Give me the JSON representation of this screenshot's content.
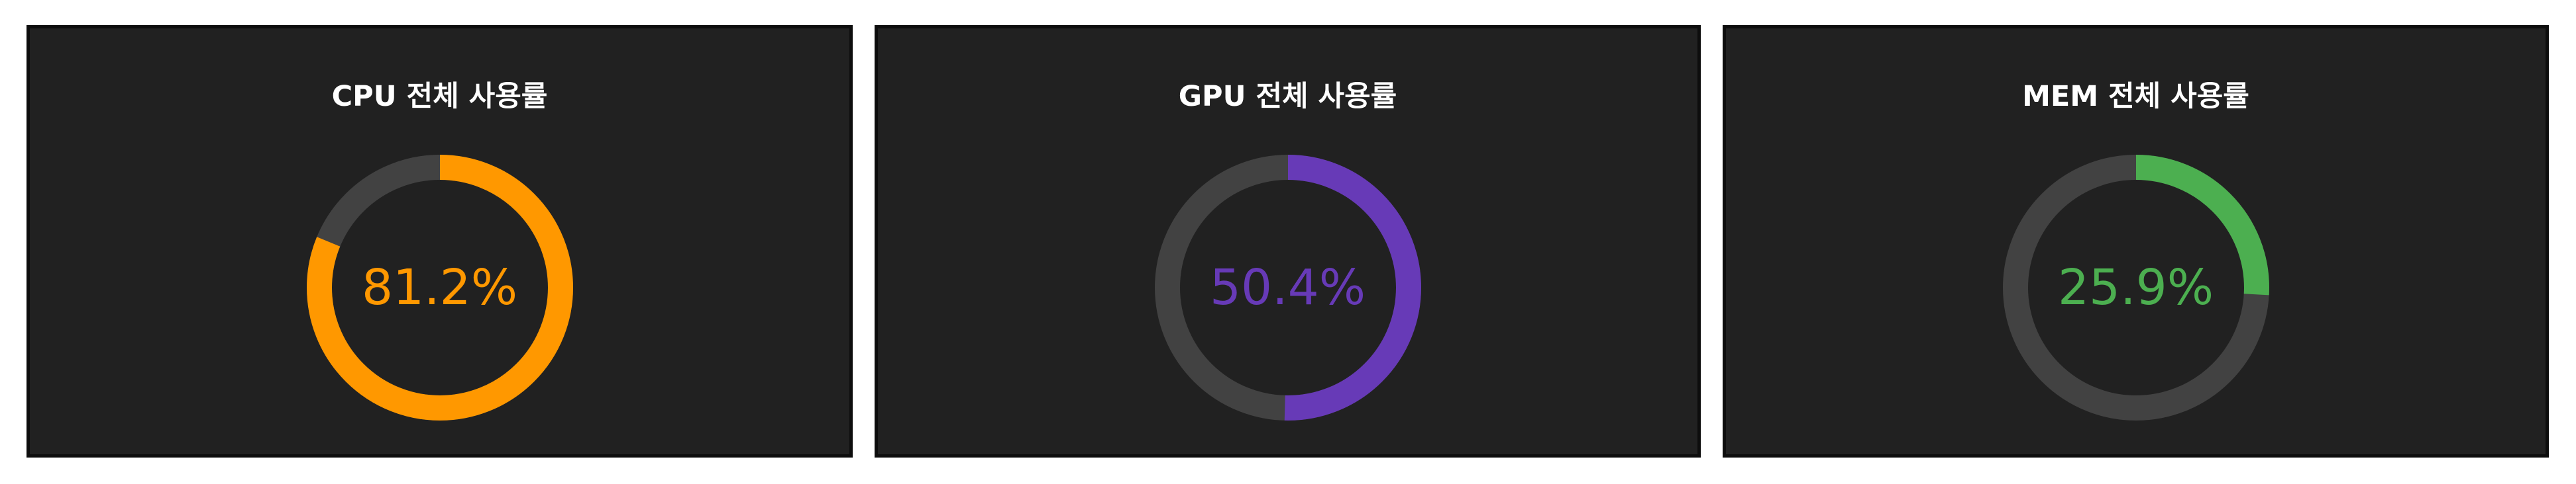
{
  "colors": {
    "panel_background": "#212121",
    "track": "#424242"
  },
  "gauges": [
    {
      "title": "CPU 전체 사용률",
      "value_label": "81.2%",
      "percent": 81.2,
      "color": "#FF9800"
    },
    {
      "title": "GPU 전체 사용률",
      "value_label": "50.4%",
      "percent": 50.4,
      "color": "#673AB7"
    },
    {
      "title": "MEM 전체 사용률",
      "value_label": "25.9%",
      "percent": 25.9,
      "color": "#4CAF50"
    }
  ]
}
